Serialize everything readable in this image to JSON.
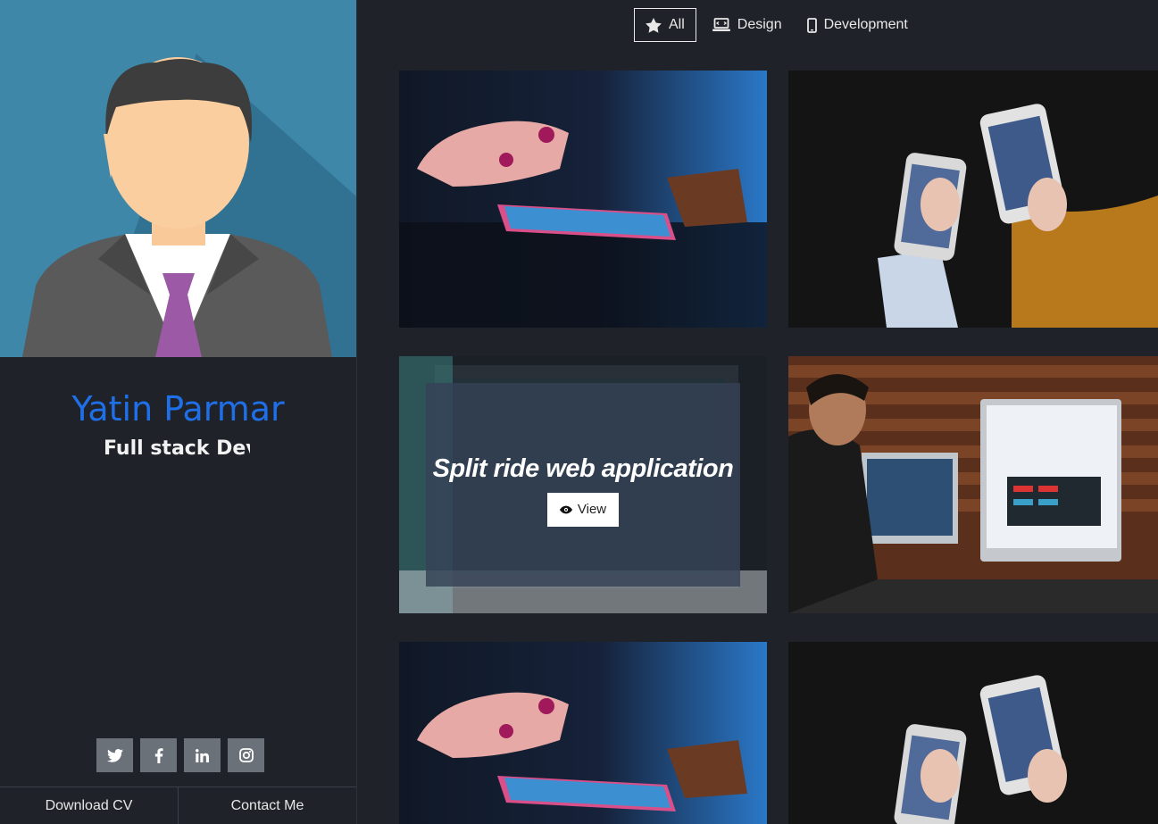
{
  "profile": {
    "name": "Yatin Parmar",
    "role": "Full stack Developer"
  },
  "social": {
    "items": [
      {
        "icon": "twitter-icon"
      },
      {
        "icon": "facebook-icon"
      },
      {
        "icon": "linkedin-icon"
      },
      {
        "icon": "instagram-icon"
      }
    ]
  },
  "cta": {
    "download_label": "Download CV",
    "contact_label": "Contact Me"
  },
  "filters": {
    "active": "All",
    "items": [
      {
        "label": "All",
        "icon": "star-icon"
      },
      {
        "label": "Design",
        "icon": "laptop-icon"
      },
      {
        "label": "Development",
        "icon": "mobile-icon"
      }
    ]
  },
  "portfolio": {
    "hovered_title": "Split ride web application",
    "view_label": "View"
  },
  "colors": {
    "accent": "#1f6fe8",
    "background": "#1f2329",
    "avatar_bg": "#3e86a8"
  }
}
